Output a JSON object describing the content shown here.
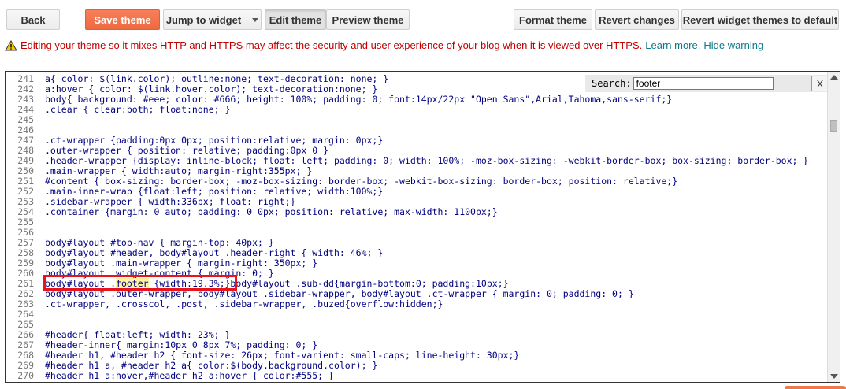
{
  "toolbar": {
    "back": "Back",
    "save_theme": "Save theme",
    "jump_to_widget": "Jump to widget",
    "edit_theme": "Edit theme",
    "preview_theme": "Preview theme",
    "format_theme": "Format theme",
    "revert_changes": "Revert changes",
    "revert_widget_themes": "Revert widget themes to default"
  },
  "warning": {
    "icon": "warning-triangle-icon",
    "text": "Editing your theme so it mixes HTTP and HTTPS may affect the security and user experience of your blog when it is viewed over HTTPS.",
    "learn_more": "Learn more.",
    "hide_warning": "Hide warning"
  },
  "search": {
    "label": "Search:",
    "value": "footer",
    "close": "X"
  },
  "highlight_color": "#e8141c",
  "code_lines": [
    {
      "n": "241",
      "pre": "a{ color: $(link.color); outline:none; text-decoration: none; }"
    },
    {
      "n": "242",
      "pre": "a:hover { color: $(link.hover.color); text-decoration:none; }"
    },
    {
      "n": "243",
      "pre": "body{ background: #eee; color: #666; height: 100%; padding: 0; font:14px/22px \"Open Sans\",Arial,Tahoma,sans-serif;}"
    },
    {
      "n": "244",
      "pre": ".clear { clear:both; float:none; }"
    },
    {
      "n": "245",
      "pre": ""
    },
    {
      "n": "246",
      "pre": ""
    },
    {
      "n": "247",
      "pre": ".ct-wrapper {padding:0px 0px; position:relative; margin: 0px;}"
    },
    {
      "n": "248",
      "pre": ".outer-wrapper { position: relative; padding:0px 0 }"
    },
    {
      "n": "249",
      "pre": ".header-wrapper {display: inline-block; float: left; padding: 0; width: 100%; -moz-box-sizing: -webkit-border-box; box-sizing: border-box; }"
    },
    {
      "n": "250",
      "pre": ".main-wrapper { width:auto; margin-right:355px; }"
    },
    {
      "n": "251",
      "pre": "#content { box-sizing: border-box; -moz-box-sizing: border-box; -webkit-box-sizing: border-box; position: relative;}"
    },
    {
      "n": "252",
      "pre": ".main-inner-wrap {float:left; position: relative; width:100%;}"
    },
    {
      "n": "253",
      "pre": ".sidebar-wrapper { width:336px; float: right;}"
    },
    {
      "n": "254",
      "pre": ".container {margin: 0 auto; padding: 0 0px; position: relative; max-width: 1100px;}"
    },
    {
      "n": "255",
      "pre": ""
    },
    {
      "n": "256",
      "pre": ""
    },
    {
      "n": "257",
      "pre": "body#layout #top-nav { margin-top: 40px; }"
    },
    {
      "n": "258",
      "pre": "body#layout #header, body#layout .header-right { width: 46%; }"
    },
    {
      "n": "259",
      "pre": "body#layout .main-wrapper { margin-right: 350px; }"
    },
    {
      "n": "260",
      "pre": "body#layout .widget-content { margin: 0; }"
    },
    {
      "n": "261",
      "pre": "body#layout .",
      "match": "footer",
      "post": " {width:19.3%;}body#layout .sub-dd{margin-bottom:0; padding:10px;}"
    },
    {
      "n": "262",
      "pre": "body#layout .outer-wrapper, body#layout .sidebar-wrapper, body#layout .ct-wrapper { margin: 0; padding: 0; }"
    },
    {
      "n": "263",
      "pre": ".ct-wrapper, .crosscol, .post, .sidebar-wrapper, .buzed{overflow:hidden;}"
    },
    {
      "n": "264",
      "pre": ""
    },
    {
      "n": "265",
      "pre": ""
    },
    {
      "n": "266",
      "pre": "#header{ float:left; width: 23%; }"
    },
    {
      "n": "267",
      "pre": "#header-inner{ margin:10px 0 8px 7%; padding: 0; }"
    },
    {
      "n": "268",
      "pre": "#header h1, #header h2 { font-size: 26px; font-varient: small-caps; line-height: 30px;}"
    },
    {
      "n": "269",
      "pre": "#header h1 a, #header h2 a{ color:$(body.background.color); }"
    },
    {
      "n": "270",
      "pre": "#header h1 a:hover,#header h2 a:hover { color:#555; }"
    }
  ]
}
